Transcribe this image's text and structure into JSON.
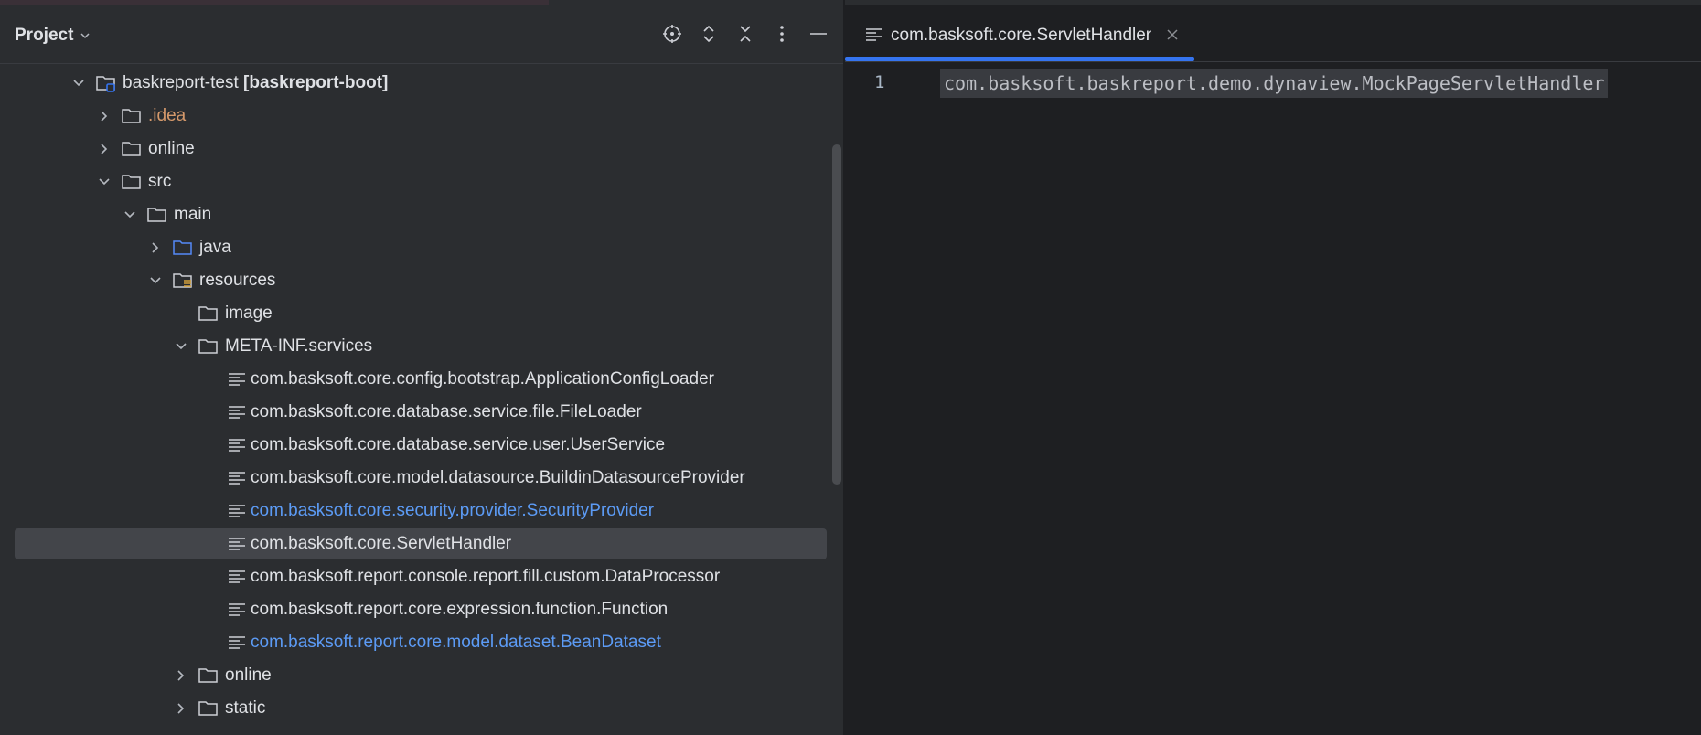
{
  "panel": {
    "title": "Project",
    "tools": [
      "locate-icon",
      "expand-all-icon",
      "collapse-all-icon",
      "more-options-icon",
      "minimize-icon"
    ]
  },
  "tree": {
    "root_name": "baskreport-test",
    "root_module": "[baskreport-boot]",
    "idea": ".idea",
    "online_top": "online",
    "src": "src",
    "main": "main",
    "java": "java",
    "resources": "resources",
    "image": "image",
    "meta_inf": "META-INF.services",
    "services": [
      "com.basksoft.core.config.bootstrap.ApplicationConfigLoader",
      "com.basksoft.core.database.service.file.FileLoader",
      "com.basksoft.core.database.service.user.UserService",
      "com.basksoft.core.model.datasource.BuildinDatasourceProvider",
      "com.basksoft.core.security.provider.SecurityProvider",
      "com.basksoft.core.ServletHandler",
      "com.basksoft.report.console.report.fill.custom.DataProcessor",
      "com.basksoft.report.core.expression.function.Function",
      "com.basksoft.report.core.model.dataset.BeanDataset"
    ],
    "online_res": "online",
    "static": "static"
  },
  "editor": {
    "tab_label": "com.basksoft.core.ServletHandler",
    "line_number": "1",
    "code": "com.basksoft.baskreport.demo.dynaview.MockPageServletHandler"
  },
  "colors": {
    "accent": "#3574f0",
    "modified_blue": "#5c9bf5",
    "excluded_orange": "#d5996b"
  }
}
